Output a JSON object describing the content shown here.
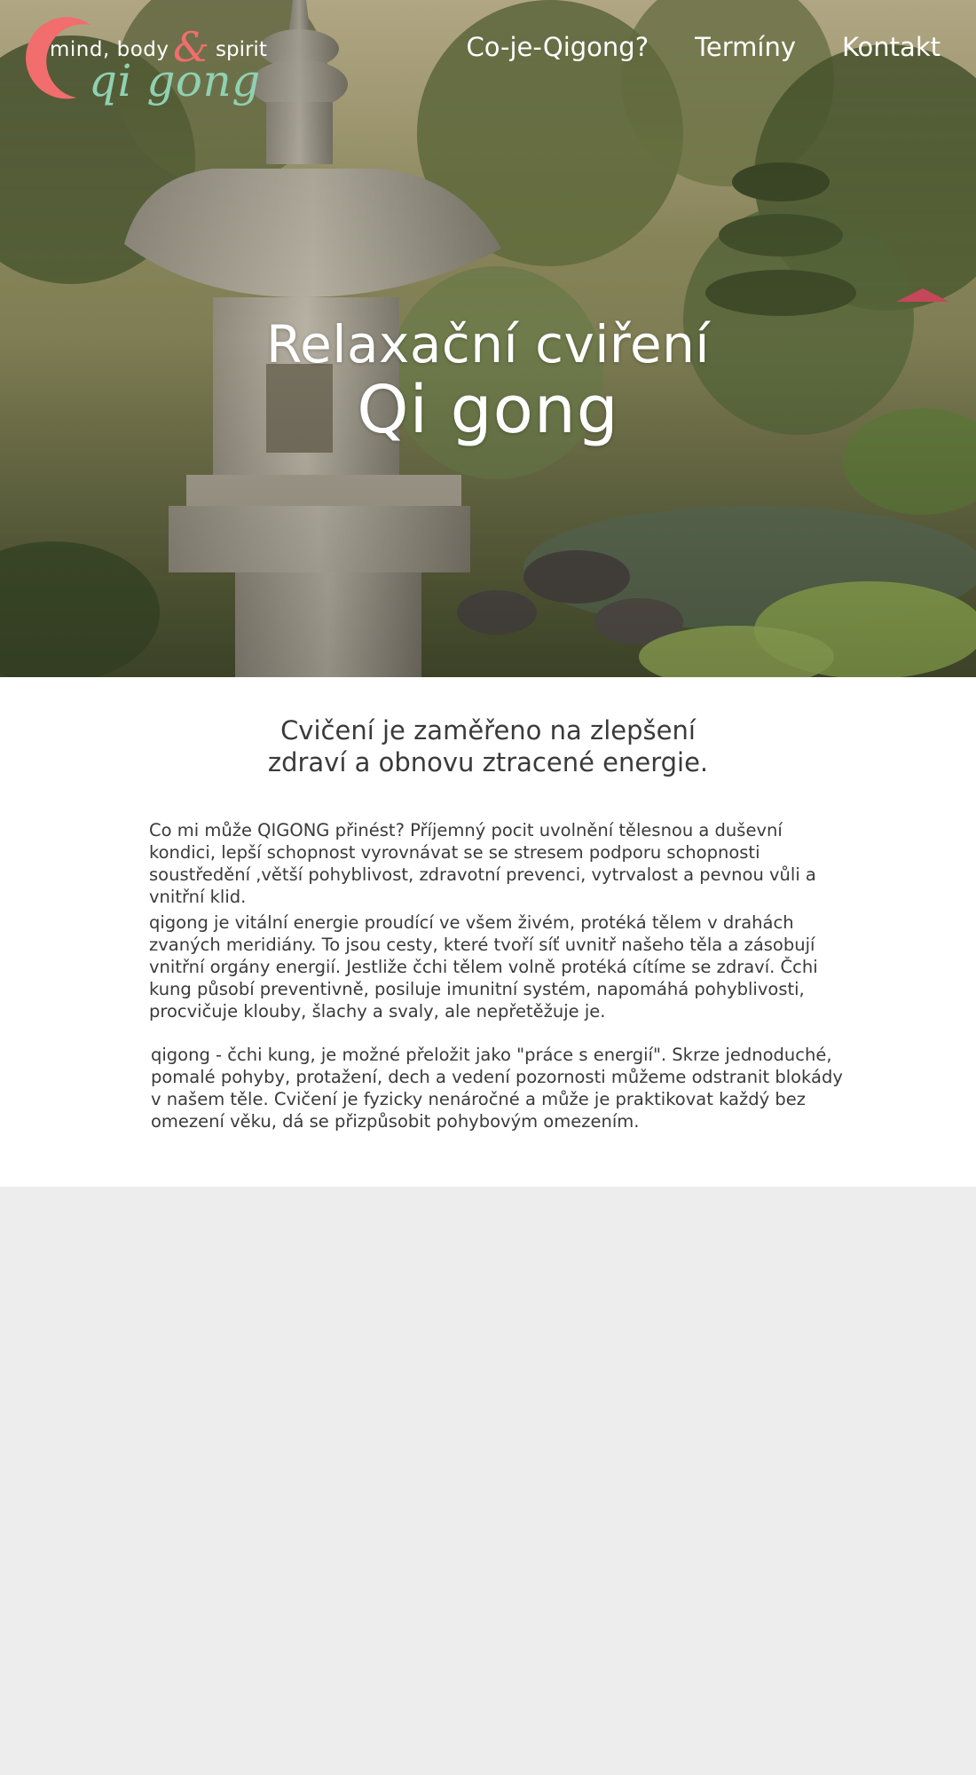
{
  "logo": {
    "line1_mind": "mind, body",
    "ampersand": "&",
    "line1_spirit": "spirit",
    "line2": "qi gong",
    "colors": {
      "swoosh": "#f26d6d",
      "ampersand": "#f26d6d",
      "qigong": "#8fd1b2"
    }
  },
  "nav": {
    "items": [
      {
        "label": "Co-je-Qigong?"
      },
      {
        "label": "Termíny"
      },
      {
        "label": "Kontakt"
      }
    ]
  },
  "hero": {
    "title_line1": "Relaxační cviření",
    "title_line2": "Qi gong",
    "image": "stone-lantern-garden"
  },
  "main": {
    "lead_line1": "Cvičení je zaměřeno na zlepšení",
    "lead_line2": "zdraví a obnovu ztracené energie.",
    "paragraphs": [
      "Co mi může QIGONG přinést? Příjemný pocit uvolnění tělesnou a duševní kondici, lepší schopnost vyrovnávat se se stresem podporu schopnosti soustředění ,větší pohyblivost, zdravotní prevenci, vytrvalost a pevnou vůli a vnitřní klid.",
      "qigong je vitální energie proudící ve všem živém, protéká tělem v drahách zvaných meridiány. To jsou cesty, které tvoří síť uvnitř našeho těla a zásobují vnitřní orgány energií. Jestliže čchi tělem volně protéká cítíme se zdraví. Čchi kung působí preventivně, posiluje imunitní systém, napomáhá pohyblivosti, procvičuje klouby, šlachy a svaly, ale nepřetěžuje je.",
      "qigong - čchi kung, je možné přeložit jako \"práce s energií\". Skrze jednoduché, pomalé pohyby, protažení, dech a vedení pozornosti můžeme odstranit blokády v našem těle. Cvičení je fyzicky nenáročné a může je praktikovat každý bez omezení věku, dá se přizpůsobit pohybovým omezením."
    ]
  }
}
